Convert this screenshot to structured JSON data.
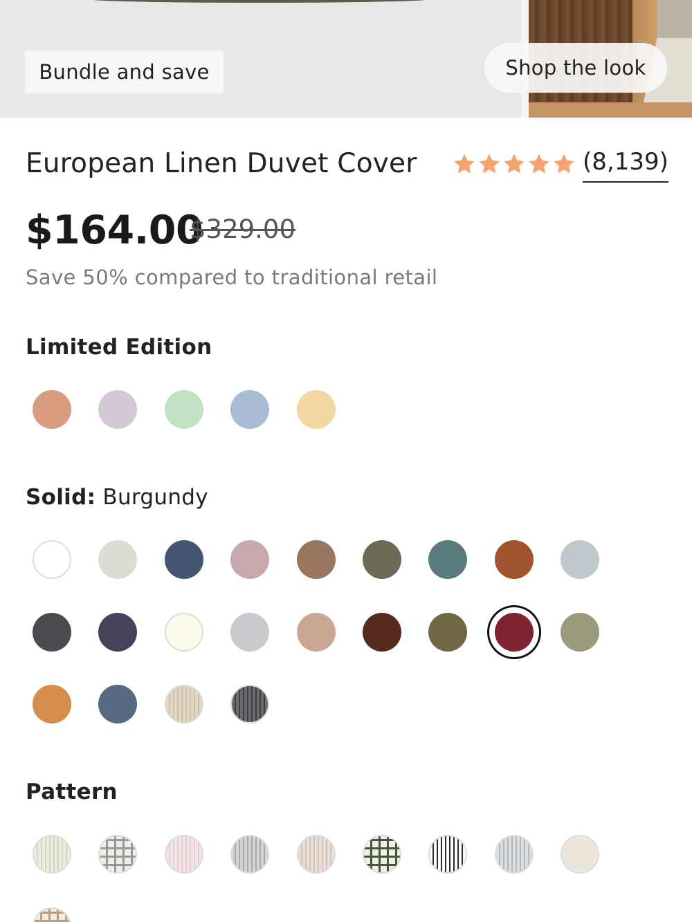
{
  "hero": {
    "bundle_label": "Bundle and save",
    "shop_label": "Shop the look"
  },
  "product": {
    "title": "European Linen Duvet Cover",
    "rating_stars": 5,
    "review_count": "(8,139)",
    "price": "$164.00",
    "compare_price": "$329.00",
    "savings_text": "Save 50% compared to traditional retail"
  },
  "colors": {
    "star": "#f4a372",
    "selected_ring": "#111111"
  },
  "limited_edition": {
    "title": "Limited Edition",
    "swatches": [
      {
        "color": "#d99c7e"
      },
      {
        "color": "#d5c8d6"
      },
      {
        "color": "#c2e2c4"
      },
      {
        "color": "#a8bdd5"
      },
      {
        "color": "#f2d7a0"
      }
    ]
  },
  "solid": {
    "title": "Solid:",
    "selected_name": "Burgundy",
    "selected_index": 16,
    "swatches": [
      {
        "color": "#ffffff",
        "kind": "plain"
      },
      {
        "color": "#dcdcd4",
        "kind": "plain"
      },
      {
        "color": "#435672",
        "kind": "plain"
      },
      {
        "color": "#c8a8ab",
        "kind": "plain"
      },
      {
        "color": "#9a7661",
        "kind": "plain"
      },
      {
        "color": "#6b6b55",
        "kind": "plain"
      },
      {
        "color": "#5a7c7e",
        "kind": "plain"
      },
      {
        "color": "#a0542d",
        "kind": "plain"
      },
      {
        "color": "#bfc9cd",
        "kind": "plain"
      },
      {
        "color": "#4a4b50",
        "kind": "plain"
      },
      {
        "color": "#46425a",
        "kind": "plain"
      },
      {
        "color": "#fdfcec",
        "kind": "plain"
      },
      {
        "color": "#c9cacd",
        "kind": "plain"
      },
      {
        "color": "#c9a792",
        "kind": "plain"
      },
      {
        "color": "#532a1c",
        "kind": "plain"
      },
      {
        "color": "#6f6746",
        "kind": "plain"
      },
      {
        "color": "#7e2330",
        "kind": "plain"
      },
      {
        "color": "#9c9a7c",
        "kind": "plain"
      },
      {
        "color": "#d48d4c",
        "kind": "plain"
      },
      {
        "color": "#566a84",
        "kind": "plain"
      },
      {
        "color": "#e3d8c6",
        "kind": "stripe",
        "stripe": "#cfc0a8"
      },
      {
        "color": "#6b6c6f",
        "kind": "stripe",
        "stripe": "#3c3d40"
      }
    ]
  },
  "pattern": {
    "title": "Pattern",
    "swatches": [
      {
        "color": "#ececdf",
        "kind": "stripe",
        "stripe": "#d3d4c2"
      },
      {
        "color": "#ededed",
        "kind": "grid",
        "stripe": "#9a9a8e"
      },
      {
        "color": "#f4e4e4",
        "kind": "stripe",
        "stripe": "#e3cfcf"
      },
      {
        "color": "#d4d4d2",
        "kind": "stripe",
        "stripe": "#a9aaa7"
      },
      {
        "color": "#eadfd8",
        "kind": "stripe",
        "stripe": "#d2c1b6"
      },
      {
        "color": "#eef0e6",
        "kind": "grid",
        "stripe": "#44553a"
      },
      {
        "color": "#fbfbfb",
        "kind": "stripe",
        "stripe": "#2a2a2e"
      },
      {
        "color": "#dcdee0",
        "kind": "stripe",
        "stripe": "#b4b8bc"
      },
      {
        "color": "#ede6dc",
        "kind": "plain"
      },
      {
        "color": "#f1ece4",
        "kind": "grid",
        "stripe": "#b79c86"
      }
    ]
  }
}
